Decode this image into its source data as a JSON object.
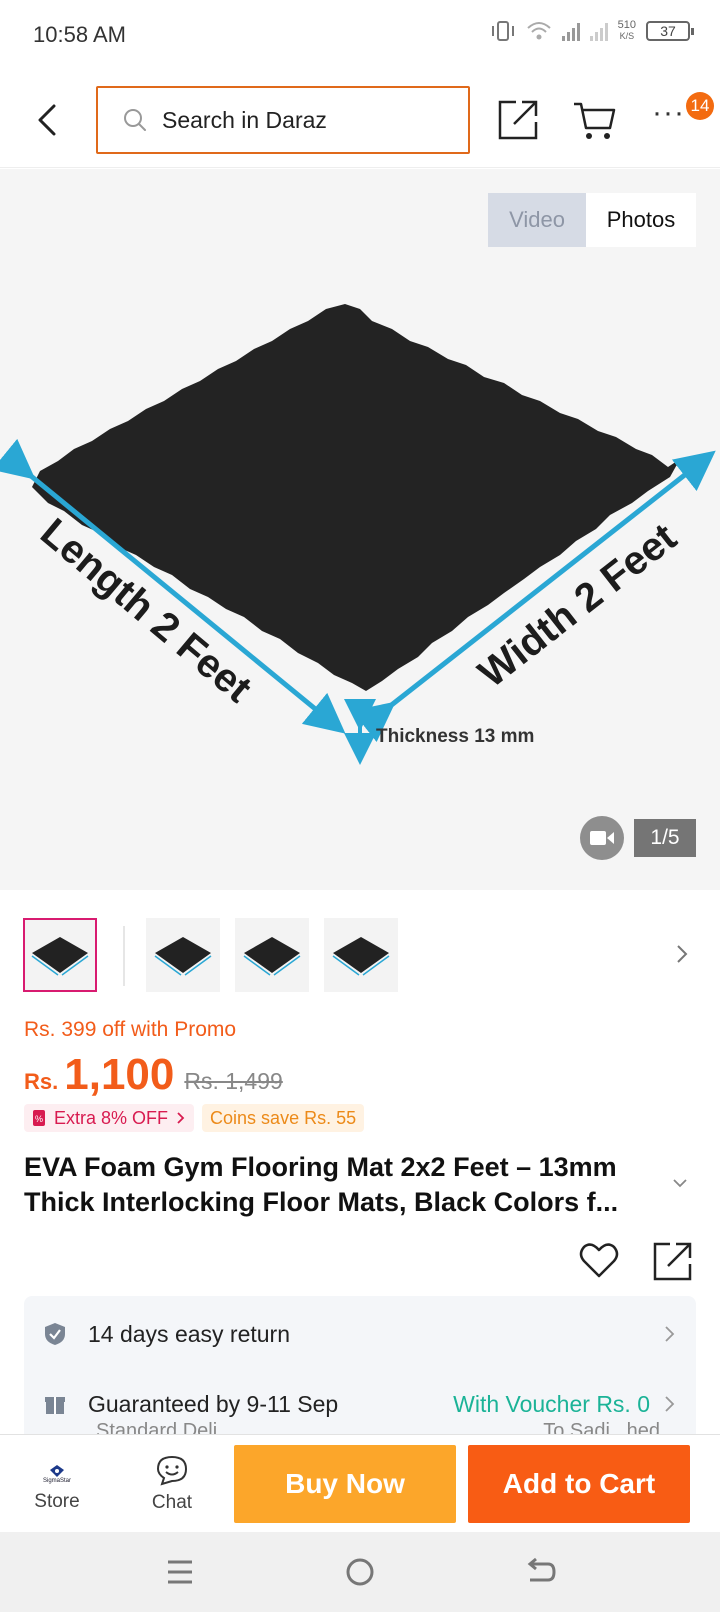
{
  "status_bar": {
    "time": "10:58 AM",
    "net_speed_value": "510",
    "net_speed_unit": "K/S",
    "battery": "37"
  },
  "header": {
    "search_placeholder": "Search in Daraz",
    "more_badge": "14"
  },
  "gallery": {
    "tabs": [
      "Video",
      "Photos"
    ],
    "active_tab": "Photos",
    "counter": "1/5",
    "image_labels": {
      "length": "Length 2 Feet",
      "width": "Width 2 Feet",
      "thickness": "Thickness 13 mm"
    },
    "thumbnail_count": 4,
    "selected_thumbnail": 1
  },
  "price": {
    "promo": "Rs. 399 off with Promo",
    "currency": "Rs.",
    "value": "1,100",
    "original": "Rs. 1,499",
    "badge_extra": "Extra 8% OFF",
    "badge_coins": "Coins save Rs. 55"
  },
  "product": {
    "title": "EVA Foam Gym Flooring Mat 2x2 Feet – 13mm Thick Interlocking Floor Mats, Black Colors f..."
  },
  "info": {
    "return_text": "14 days easy return",
    "delivery_text": "Guaranteed by 9-11 Sep",
    "voucher_text": "With Voucher Rs. 0",
    "sub_left": "Standard Deli...",
    "sub_right": "To Sadi...hed"
  },
  "bottom_bar": {
    "store_label": "Store",
    "store_logo_text": "SigmaStar",
    "chat_label": "Chat",
    "buy_now": "Buy Now",
    "add_to_cart": "Add to Cart"
  },
  "colors": {
    "brand_orange": "#f85c14",
    "buy_now": "#fca62a",
    "promo_text": "#f25c1a",
    "voucher_green": "#1bb397",
    "arrow_blue": "#2aa7d4"
  }
}
